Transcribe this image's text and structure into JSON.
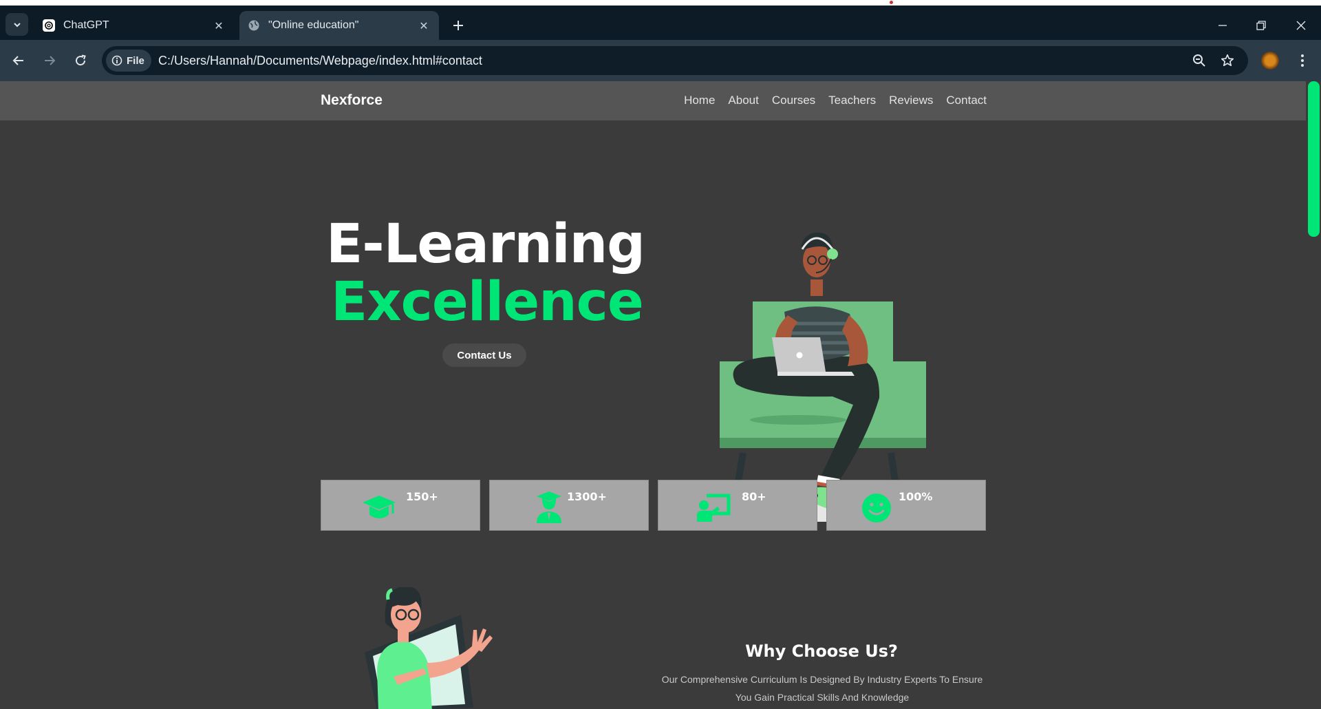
{
  "browser": {
    "tabs": [
      {
        "title": "ChatGPT",
        "favicon": "chatgpt-icon",
        "active": false
      },
      {
        "title": "\"Online education\"",
        "favicon": "globe-icon",
        "active": true
      }
    ],
    "site_chip_label": "File",
    "url": "C:/Users/Hannah/Documents/Webpage/index.html#contact"
  },
  "site": {
    "brand": "Nexforce",
    "nav": [
      "Home",
      "About",
      "Courses",
      "Teachers",
      "Reviews",
      "Contact"
    ],
    "hero": {
      "line1": "E-Learning",
      "line2": "Excellence",
      "cta": "Contact Us"
    },
    "stats": [
      {
        "icon": "graduation-cap-icon",
        "value": "150+"
      },
      {
        "icon": "graduate-student-icon",
        "value": "1300+"
      },
      {
        "icon": "teacher-board-icon",
        "value": "80+"
      },
      {
        "icon": "smiley-face-icon",
        "value": "100%"
      }
    ],
    "why": {
      "title": "Why Choose Us?",
      "text": "Our Comprehensive Curriculum Is Designed By Industry Experts To Ensure You Gain Practical Skills And Knowledge"
    }
  },
  "colors": {
    "accent": "#00e676",
    "page_bg": "#3b3b3b",
    "nav_bg": "#555555",
    "stat_bg": "#a6a6a6",
    "chrome_dark": "#0d1b27",
    "chrome_mid": "#2b3b47"
  }
}
